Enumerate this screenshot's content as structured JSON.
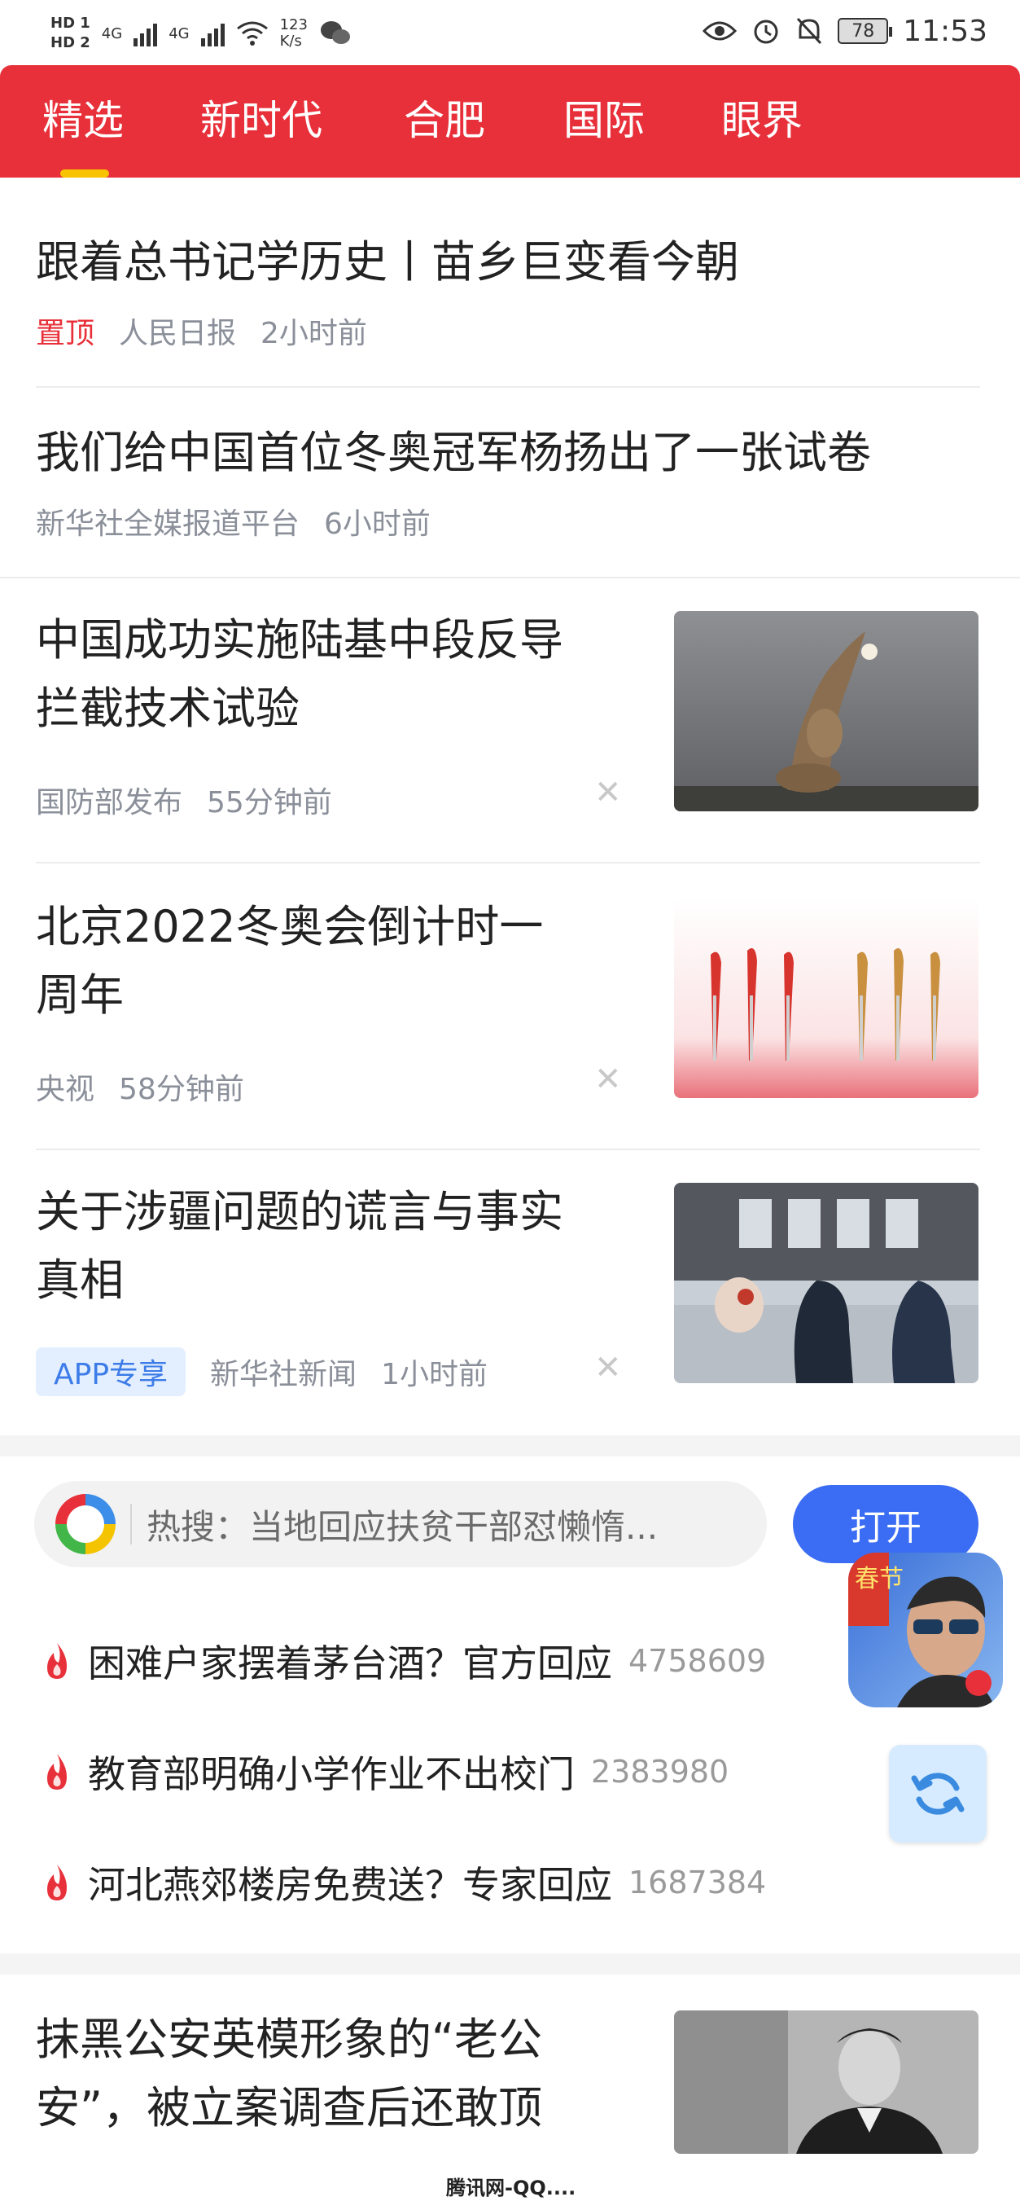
{
  "status_bar": {
    "hd1": "HD 1",
    "hd2": "HD 2",
    "net1": "4G",
    "net2": "4G",
    "speed_value": "123",
    "speed_unit": "K/s",
    "battery": "78",
    "time": "11:53"
  },
  "tabs": [
    {
      "label": "精选",
      "active": true
    },
    {
      "label": "新时代",
      "active": false
    },
    {
      "label": "合肥",
      "active": false
    },
    {
      "label": "国际",
      "active": false
    },
    {
      "label": "眼界",
      "active": false
    }
  ],
  "feed": [
    {
      "title": "跟着总书记学历史丨苗乡巨变看今朝",
      "tag": "置顶",
      "source": "人民日报",
      "time": "2小时前"
    },
    {
      "title": "我们给中国首位冬奥冠军杨扬出了一张试卷",
      "source": "新华社全媒报道平台",
      "time": "6小时前"
    },
    {
      "title_line1": "中国成功实施陆基中段反导",
      "title_line2": "拦截技术试验",
      "source": "国防部发布",
      "time": "55分钟前",
      "image": "missile-launch-photo"
    },
    {
      "title_line1": "北京2022冬奥会倒计时一",
      "title_line2": "周年",
      "source": "央视",
      "time": "58分钟前",
      "image": "olympic-torches-photo"
    },
    {
      "title_line1": "关于涉疆问题的谎言与事实",
      "title_line2": "真相",
      "badge": "APP专享",
      "source": "新华社新闻",
      "time": "1小时前",
      "image": "street-shop-photo"
    }
  ],
  "search": {
    "placeholder": "热搜：当地回应扶贫干部怼懒惰...",
    "open_label": "打开"
  },
  "hot_list": [
    {
      "title": "困难户家摆着茅台酒？官方回应",
      "count": "4758609"
    },
    {
      "title": "教育部明确小学作业不出校门",
      "count": "2383980"
    },
    {
      "title": "河北燕郊楼房免费送？专家回应",
      "count": "1687384"
    }
  ],
  "last_item": {
    "title_line1": "抹黑公安英模形象的“老公",
    "title_line2": "安”，被立案调查后还敢顶",
    "image": "police-officer-photo"
  },
  "game_icon": {
    "label": "春节"
  },
  "watermark": "腾讯网-QQ...."
}
